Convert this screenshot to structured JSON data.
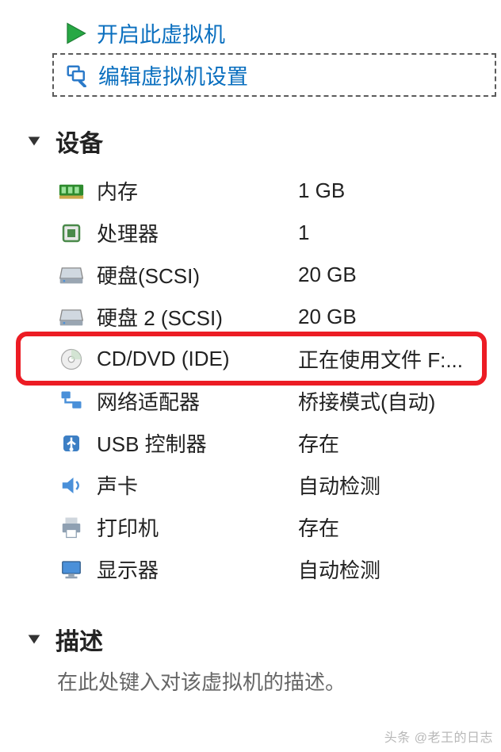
{
  "actions": {
    "power_on": "开启此虚拟机",
    "edit_settings": "编辑虚拟机设置"
  },
  "sections": {
    "devices_title": "设备",
    "description_title": "描述"
  },
  "devices": [
    {
      "icon": "memory",
      "label": "内存",
      "value": "1 GB"
    },
    {
      "icon": "cpu",
      "label": "处理器",
      "value": "1"
    },
    {
      "icon": "hdd",
      "label": "硬盘(SCSI)",
      "value": "20 GB"
    },
    {
      "icon": "hdd",
      "label": "硬盘 2 (SCSI)",
      "value": "20 GB"
    },
    {
      "icon": "cddvd",
      "label": "CD/DVD (IDE)",
      "value": "正在使用文件 F:..."
    },
    {
      "icon": "network",
      "label": "网络适配器",
      "value": "桥接模式(自动)"
    },
    {
      "icon": "usb",
      "label": "USB 控制器",
      "value": "存在"
    },
    {
      "icon": "sound",
      "label": "声卡",
      "value": "自动检测"
    },
    {
      "icon": "printer",
      "label": "打印机",
      "value": "存在"
    },
    {
      "icon": "display",
      "label": "显示器",
      "value": "自动检测"
    }
  ],
  "description_placeholder": "在此处键入对该虚拟机的描述。",
  "watermark": "头条 @老王的日志",
  "highlighted_index": 3
}
